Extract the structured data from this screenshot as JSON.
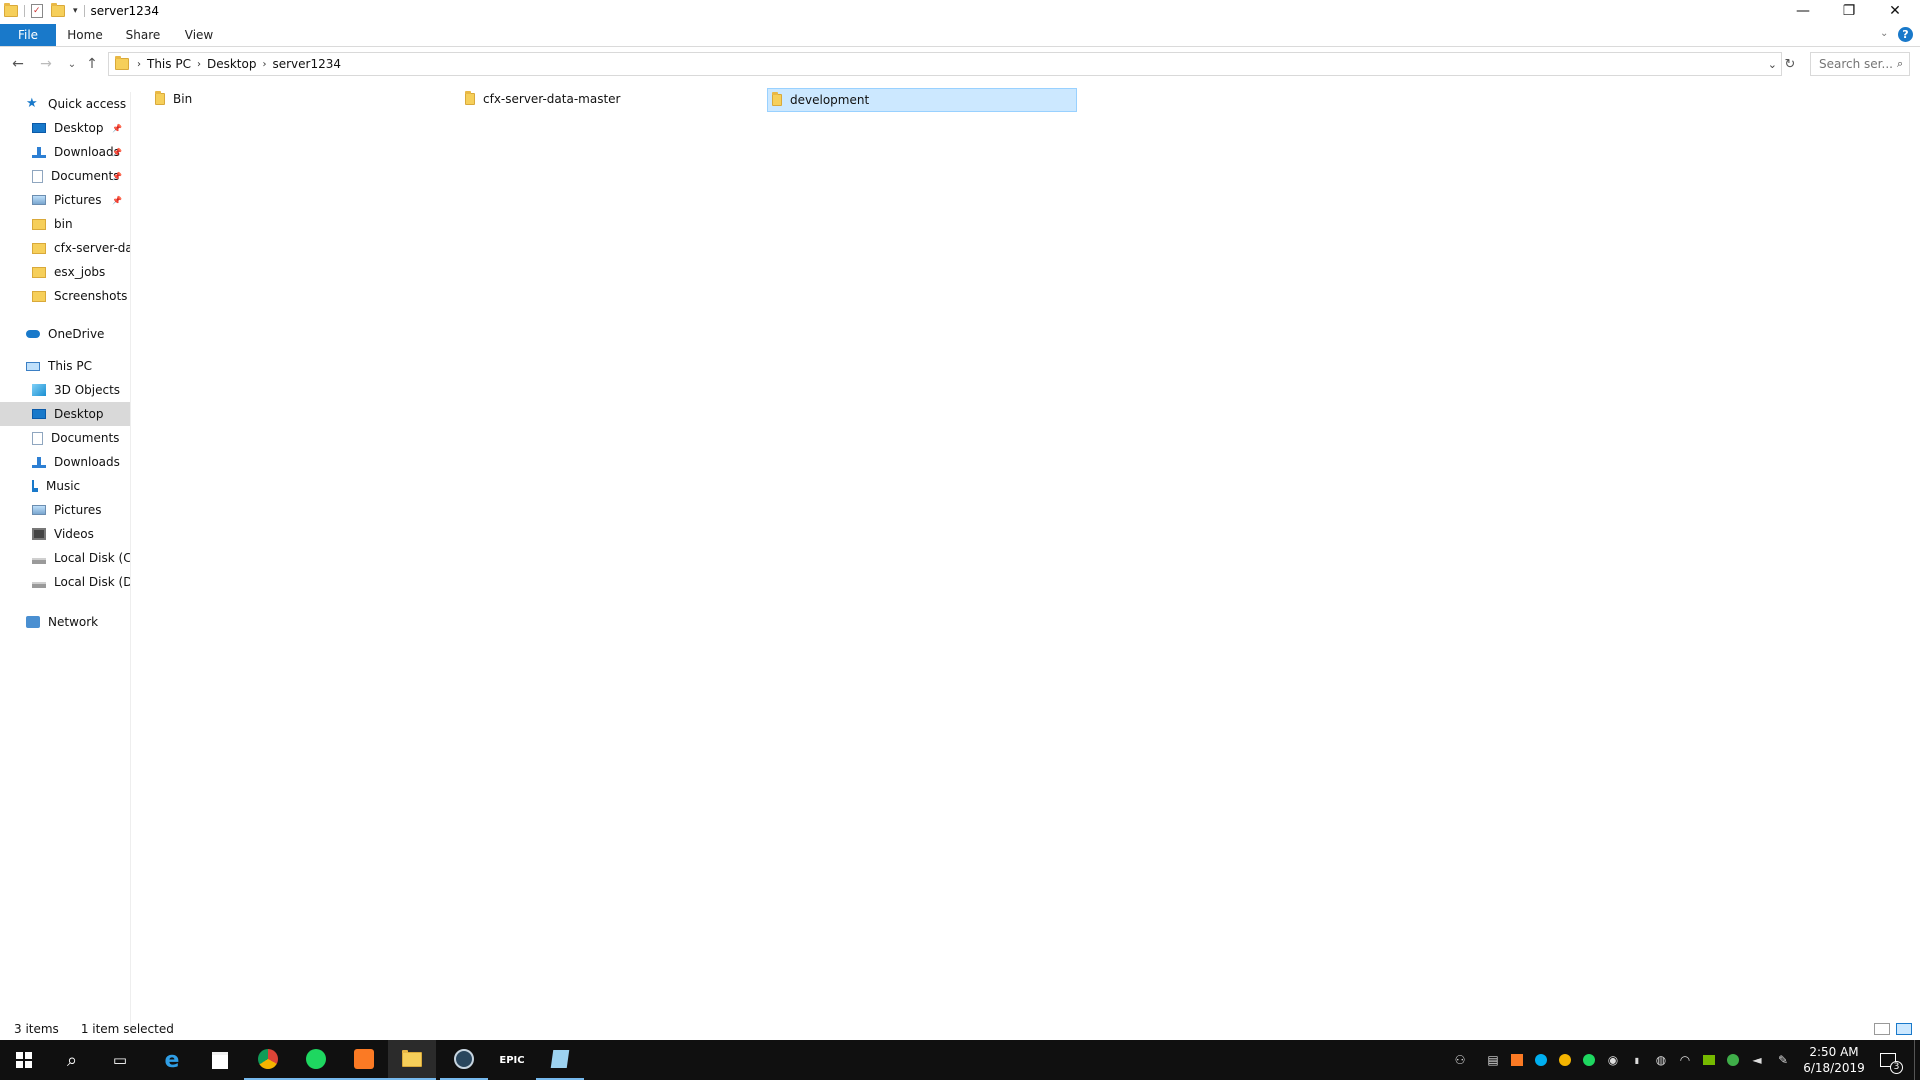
{
  "window": {
    "title": "server1234",
    "controls": {
      "minimize": "—",
      "maximize": "❐",
      "close": "✕"
    }
  },
  "ribbon": {
    "tabs": [
      "File",
      "Home",
      "Share",
      "View"
    ],
    "help": "?"
  },
  "address": {
    "crumbs": [
      "This PC",
      "Desktop",
      "server1234"
    ],
    "search_placeholder": "Search ser..."
  },
  "nav": {
    "quick_access": "Quick access",
    "quick_items": [
      {
        "label": "Desktop",
        "icon": "desktop-icon",
        "pinned": true
      },
      {
        "label": "Downloads",
        "icon": "download-icon",
        "pinned": true
      },
      {
        "label": "Documents",
        "icon": "documents-icon",
        "pinned": true
      },
      {
        "label": "Pictures",
        "icon": "pictures-icon",
        "pinned": true
      },
      {
        "label": "bin",
        "icon": "folder-icon",
        "pinned": false
      },
      {
        "label": "cfx-server-data",
        "icon": "folder-icon",
        "pinned": false
      },
      {
        "label": "esx_jobs",
        "icon": "folder-icon",
        "pinned": false
      },
      {
        "label": "Screenshots",
        "icon": "folder-icon",
        "pinned": false
      }
    ],
    "onedrive": "OneDrive",
    "this_pc": "This PC",
    "pc_items": [
      {
        "label": "3D Objects",
        "icon": "3d-objects-icon"
      },
      {
        "label": "Desktop",
        "icon": "desktop-icon"
      },
      {
        "label": "Documents",
        "icon": "documents-icon"
      },
      {
        "label": "Downloads",
        "icon": "download-icon"
      },
      {
        "label": "Music",
        "icon": "music-icon"
      },
      {
        "label": "Pictures",
        "icon": "pictures-icon"
      },
      {
        "label": "Videos",
        "icon": "videos-icon"
      },
      {
        "label": "Local Disk (C:)",
        "icon": "drive-icon"
      },
      {
        "label": "Local Disk (D:)",
        "icon": "drive-icon"
      }
    ],
    "network": "Network"
  },
  "files": [
    {
      "name": "Bin",
      "selected": false
    },
    {
      "name": "cfx-server-data-master",
      "selected": false
    },
    {
      "name": "development",
      "selected": true
    }
  ],
  "status": {
    "count": "3 items",
    "selection": "1 item selected"
  },
  "taskbar": {
    "clock_time": "2:50 AM",
    "clock_date": "6/18/2019",
    "notifications": "3",
    "epic_label": "EPIC"
  },
  "colors": {
    "accent": "#1979ca",
    "selection": "#cce8ff",
    "folder": "#f6cf5a",
    "taskbar": "#101010"
  }
}
